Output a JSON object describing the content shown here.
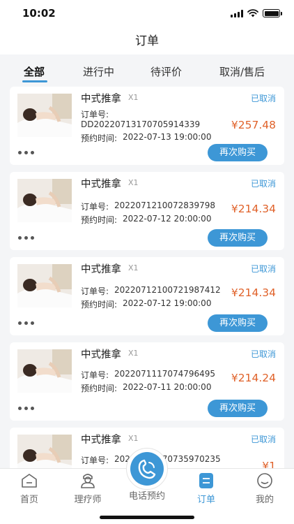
{
  "status_bar": {
    "time": "10:02"
  },
  "header": {
    "title": "订单"
  },
  "tabs": [
    {
      "label": "全部",
      "active": true
    },
    {
      "label": "进行中",
      "active": false
    },
    {
      "label": "待评价",
      "active": false
    },
    {
      "label": "取消/售后",
      "active": false
    }
  ],
  "orders": [
    {
      "service": "中式推拿",
      "qty": "X1",
      "status": "已取消",
      "order_no_label": "订单号:",
      "order_no": "DD2022071317070591433​9",
      "time_label": "预约时间:",
      "time": "2022-07-13 19:00:00",
      "price": "¥257.48",
      "action": "再次购买"
    },
    {
      "service": "中式推拿",
      "qty": "X1",
      "status": "已取消",
      "order_no_label": "订单号:",
      "order_no": "2022071210072839798",
      "time_label": "预约时间:",
      "time": "2022-07-12 20:00:00",
      "price": "¥214.34",
      "action": "再次购买"
    },
    {
      "service": "中式推拿",
      "qty": "X1",
      "status": "已取消",
      "order_no_label": "订单号:",
      "order_no": "2022071210072198741​2",
      "time_label": "预约时间:",
      "time": "2022-07-12 19:00:00",
      "price": "¥214.34",
      "action": "再次购买"
    },
    {
      "service": "中式推拿",
      "qty": "X1",
      "status": "已取消",
      "order_no_label": "订单号:",
      "order_no": "2022071117074796495",
      "time_label": "预约时间:",
      "time": "2022-07-11 20:00:00",
      "price": "¥214.24",
      "action": "再次购买"
    },
    {
      "service": "中式推拿",
      "qty": "X1",
      "status": "已取消",
      "order_no_label": "订单号:",
      "order_no": "2022071117073597023​5",
      "time_label": "",
      "time": "",
      "price": "¥1",
      "action": ""
    }
  ],
  "tab_bar": {
    "items": [
      {
        "label": "首页",
        "icon": "home-icon"
      },
      {
        "label": "理疗师",
        "icon": "therapist-icon"
      },
      {
        "label": "电话预约",
        "icon": "phone-icon"
      },
      {
        "label": "订单",
        "icon": "orders-icon"
      },
      {
        "label": "我的",
        "icon": "profile-icon"
      }
    ],
    "active": "订单",
    "accent_color": "#3d97d6"
  },
  "colors": {
    "accent": "#3d97d6",
    "price": "#e0622a",
    "background": "#f4f5f7"
  }
}
